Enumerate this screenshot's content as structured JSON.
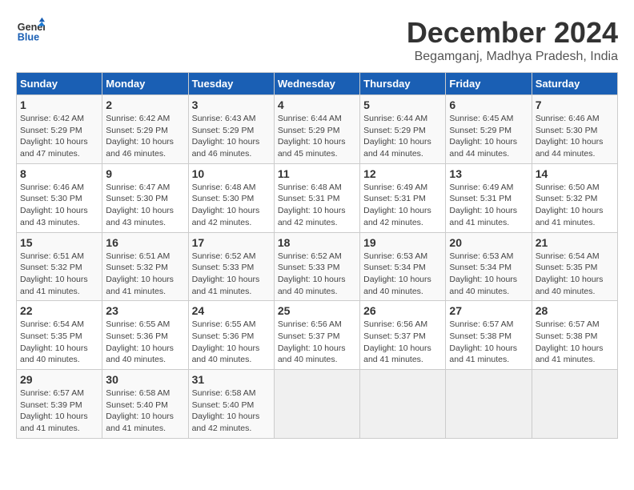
{
  "header": {
    "logo_line1": "General",
    "logo_line2": "Blue",
    "month_title": "December 2024",
    "location": "Begamganj, Madhya Pradesh, India"
  },
  "calendar": {
    "days_of_week": [
      "Sunday",
      "Monday",
      "Tuesday",
      "Wednesday",
      "Thursday",
      "Friday",
      "Saturday"
    ],
    "weeks": [
      [
        {
          "day": "1",
          "sunrise": "6:42 AM",
          "sunset": "5:29 PM",
          "daylight": "10 hours and 47 minutes."
        },
        {
          "day": "2",
          "sunrise": "6:42 AM",
          "sunset": "5:29 PM",
          "daylight": "10 hours and 46 minutes."
        },
        {
          "day": "3",
          "sunrise": "6:43 AM",
          "sunset": "5:29 PM",
          "daylight": "10 hours and 46 minutes."
        },
        {
          "day": "4",
          "sunrise": "6:44 AM",
          "sunset": "5:29 PM",
          "daylight": "10 hours and 45 minutes."
        },
        {
          "day": "5",
          "sunrise": "6:44 AM",
          "sunset": "5:29 PM",
          "daylight": "10 hours and 44 minutes."
        },
        {
          "day": "6",
          "sunrise": "6:45 AM",
          "sunset": "5:29 PM",
          "daylight": "10 hours and 44 minutes."
        },
        {
          "day": "7",
          "sunrise": "6:46 AM",
          "sunset": "5:30 PM",
          "daylight": "10 hours and 44 minutes."
        }
      ],
      [
        {
          "day": "8",
          "sunrise": "6:46 AM",
          "sunset": "5:30 PM",
          "daylight": "10 hours and 43 minutes."
        },
        {
          "day": "9",
          "sunrise": "6:47 AM",
          "sunset": "5:30 PM",
          "daylight": "10 hours and 43 minutes."
        },
        {
          "day": "10",
          "sunrise": "6:48 AM",
          "sunset": "5:30 PM",
          "daylight": "10 hours and 42 minutes."
        },
        {
          "day": "11",
          "sunrise": "6:48 AM",
          "sunset": "5:31 PM",
          "daylight": "10 hours and 42 minutes."
        },
        {
          "day": "12",
          "sunrise": "6:49 AM",
          "sunset": "5:31 PM",
          "daylight": "10 hours and 42 minutes."
        },
        {
          "day": "13",
          "sunrise": "6:49 AM",
          "sunset": "5:31 PM",
          "daylight": "10 hours and 41 minutes."
        },
        {
          "day": "14",
          "sunrise": "6:50 AM",
          "sunset": "5:32 PM",
          "daylight": "10 hours and 41 minutes."
        }
      ],
      [
        {
          "day": "15",
          "sunrise": "6:51 AM",
          "sunset": "5:32 PM",
          "daylight": "10 hours and 41 minutes."
        },
        {
          "day": "16",
          "sunrise": "6:51 AM",
          "sunset": "5:32 PM",
          "daylight": "10 hours and 41 minutes."
        },
        {
          "day": "17",
          "sunrise": "6:52 AM",
          "sunset": "5:33 PM",
          "daylight": "10 hours and 41 minutes."
        },
        {
          "day": "18",
          "sunrise": "6:52 AM",
          "sunset": "5:33 PM",
          "daylight": "10 hours and 40 minutes."
        },
        {
          "day": "19",
          "sunrise": "6:53 AM",
          "sunset": "5:34 PM",
          "daylight": "10 hours and 40 minutes."
        },
        {
          "day": "20",
          "sunrise": "6:53 AM",
          "sunset": "5:34 PM",
          "daylight": "10 hours and 40 minutes."
        },
        {
          "day": "21",
          "sunrise": "6:54 AM",
          "sunset": "5:35 PM",
          "daylight": "10 hours and 40 minutes."
        }
      ],
      [
        {
          "day": "22",
          "sunrise": "6:54 AM",
          "sunset": "5:35 PM",
          "daylight": "10 hours and 40 minutes."
        },
        {
          "day": "23",
          "sunrise": "6:55 AM",
          "sunset": "5:36 PM",
          "daylight": "10 hours and 40 minutes."
        },
        {
          "day": "24",
          "sunrise": "6:55 AM",
          "sunset": "5:36 PM",
          "daylight": "10 hours and 40 minutes."
        },
        {
          "day": "25",
          "sunrise": "6:56 AM",
          "sunset": "5:37 PM",
          "daylight": "10 hours and 40 minutes."
        },
        {
          "day": "26",
          "sunrise": "6:56 AM",
          "sunset": "5:37 PM",
          "daylight": "10 hours and 41 minutes."
        },
        {
          "day": "27",
          "sunrise": "6:57 AM",
          "sunset": "5:38 PM",
          "daylight": "10 hours and 41 minutes."
        },
        {
          "day": "28",
          "sunrise": "6:57 AM",
          "sunset": "5:38 PM",
          "daylight": "10 hours and 41 minutes."
        }
      ],
      [
        {
          "day": "29",
          "sunrise": "6:57 AM",
          "sunset": "5:39 PM",
          "daylight": "10 hours and 41 minutes."
        },
        {
          "day": "30",
          "sunrise": "6:58 AM",
          "sunset": "5:40 PM",
          "daylight": "10 hours and 41 minutes."
        },
        {
          "day": "31",
          "sunrise": "6:58 AM",
          "sunset": "5:40 PM",
          "daylight": "10 hours and 42 minutes."
        },
        null,
        null,
        null,
        null
      ]
    ],
    "labels": {
      "sunrise": "Sunrise:",
      "sunset": "Sunset:",
      "daylight": "Daylight:"
    }
  }
}
